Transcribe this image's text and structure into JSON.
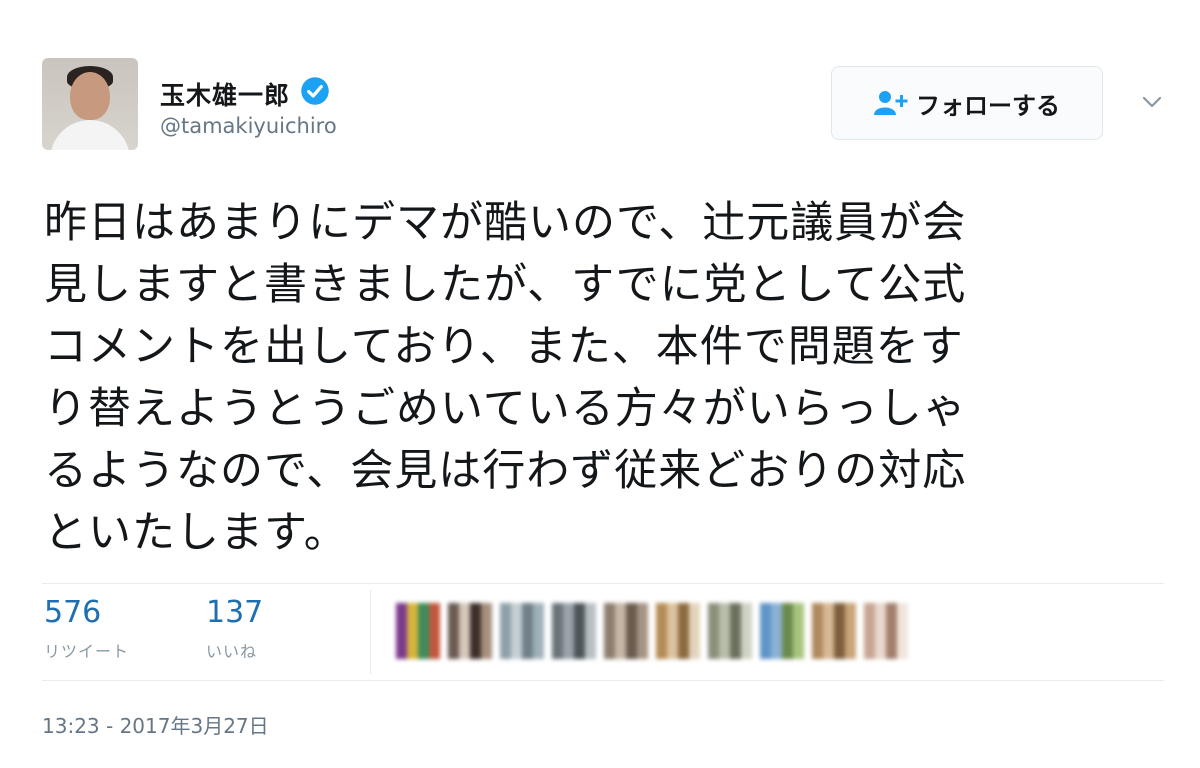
{
  "user": {
    "display_name": "玉木雄一郎",
    "handle": "@tamakiyuichiro",
    "verified": true,
    "avatar_icon": "profile-photo"
  },
  "follow_button": {
    "label": "フォローする",
    "icon": "add-user-icon"
  },
  "menu_icon": "chevron-down-icon",
  "tweet": {
    "text_lines": [
      "昨日はあまりにデマが酷いので、辻元議員が会",
      "見しますと書きましたが、すでに党として公式",
      "コメントを出しており、また、本件で問題をす",
      "り替えようとうごめいている方々がいらっしゃ",
      "るようなので、会見は行わず従来どおりの対応",
      "といたします。"
    ]
  },
  "stats": {
    "retweets": {
      "count": "576",
      "label": "リツイート"
    },
    "likes": {
      "count": "137",
      "label": "いいね"
    }
  },
  "likers": [
    {
      "colors": [
        "#7b3a8c",
        "#d8b43a",
        "#3e8c5b",
        "#c2573d"
      ]
    },
    {
      "colors": [
        "#6a5a52",
        "#d7c8bb",
        "#3c2f2a",
        "#a78f7e"
      ]
    },
    {
      "colors": [
        "#8ea0a8",
        "#c5cfd4",
        "#6f8088",
        "#9fb1b8"
      ]
    },
    {
      "colors": [
        "#6b737a",
        "#9aa3aa",
        "#4c545a",
        "#b8bfc4"
      ]
    },
    {
      "colors": [
        "#8e7d6e",
        "#c6b7a6",
        "#6a5b4f",
        "#a69483"
      ]
    },
    {
      "colors": [
        "#b58b55",
        "#dcc3a0",
        "#8c6a3f",
        "#e4d4bd"
      ]
    },
    {
      "colors": [
        "#8a8f7a",
        "#b9bea9",
        "#6b705d",
        "#cfd3c3"
      ]
    },
    {
      "colors": [
        "#5f94c9",
        "#8bb2d6",
        "#6c8a4a",
        "#a7c47f"
      ]
    },
    {
      "colors": [
        "#b0895e",
        "#d7b995",
        "#7d5f3d",
        "#c9a47a"
      ]
    },
    {
      "colors": [
        "#c7a592",
        "#ead8cc",
        "#a27e6b",
        "#f0e6dd"
      ]
    }
  ],
  "timestamp": "13:23 - 2017年3月27日",
  "colors": {
    "link_blue": "#1da1f2",
    "stat_blue": "#1f6fb0",
    "muted_gray": "#657786",
    "divider": "#e6ecf0"
  }
}
